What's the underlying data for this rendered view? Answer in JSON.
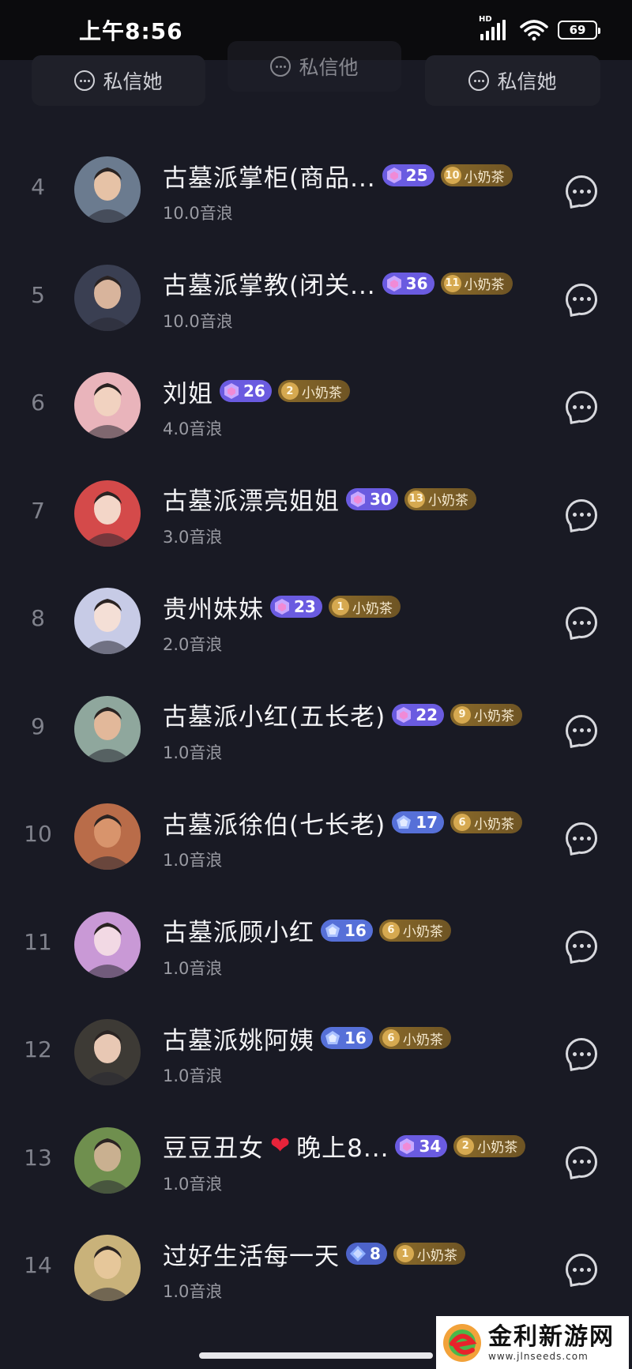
{
  "status_bar": {
    "time": "上午8:56",
    "network_label": "HD",
    "battery": "69"
  },
  "top_buttons": [
    {
      "label": "私信她"
    },
    {
      "label": "私信他"
    },
    {
      "label": "私信她"
    }
  ],
  "list": [
    {
      "rank": "4",
      "name": "古墓派掌柜(商品...",
      "level": "25",
      "level_type": "purple",
      "fan_level": "10",
      "fan_label": "小奶茶",
      "amount": "10.0音浪",
      "avatar_bg": "#6b7b8f",
      "avatar_fg": "#e6c2a6"
    },
    {
      "rank": "5",
      "name": "古墓派掌教(闭关...",
      "level": "36",
      "level_type": "purple",
      "fan_level": "11",
      "fan_label": "小奶茶",
      "amount": "10.0音浪",
      "avatar_bg": "#3a3f52",
      "avatar_fg": "#d8b49c"
    },
    {
      "rank": "6",
      "name": "刘姐",
      "level": "26",
      "level_type": "purple",
      "fan_level": "2",
      "fan_label": "小奶茶",
      "amount": "4.0音浪",
      "avatar_bg": "#e9b4bb",
      "avatar_fg": "#f1d2c0"
    },
    {
      "rank": "7",
      "name": "古墓派漂亮姐姐",
      "level": "30",
      "level_type": "purple",
      "fan_level": "13",
      "fan_label": "小奶茶",
      "amount": "3.0音浪",
      "avatar_bg": "#d44a4a",
      "avatar_fg": "#f3d6c8"
    },
    {
      "rank": "8",
      "name": "贵州妹妹",
      "level": "23",
      "level_type": "purple",
      "fan_level": "1",
      "fan_label": "小奶茶",
      "amount": "2.0音浪",
      "avatar_bg": "#c7cbe6",
      "avatar_fg": "#f4dfd6"
    },
    {
      "rank": "9",
      "name": "古墓派小红(五长老)",
      "level": "22",
      "level_type": "purple",
      "fan_level": "9",
      "fan_label": "小奶茶",
      "amount": "1.0音浪",
      "avatar_bg": "#8fa79d",
      "avatar_fg": "#e2b89a"
    },
    {
      "rank": "10",
      "name": "古墓派徐伯(七长老)",
      "level": "17",
      "level_type": "blue",
      "fan_level": "6",
      "fan_label": "小奶茶",
      "amount": "1.0音浪",
      "avatar_bg": "#b96c49",
      "avatar_fg": "#d8946c"
    },
    {
      "rank": "11",
      "name": "古墓派顾小红",
      "level": "16",
      "level_type": "blue",
      "fan_level": "6",
      "fan_label": "小奶茶",
      "amount": "1.0音浪",
      "avatar_bg": "#c999d6",
      "avatar_fg": "#f2d9e4"
    },
    {
      "rank": "12",
      "name": "古墓派姚阿姨",
      "level": "16",
      "level_type": "blue",
      "fan_level": "6",
      "fan_label": "小奶茶",
      "amount": "1.0音浪",
      "avatar_bg": "#3d3a35",
      "avatar_fg": "#e8c8b4"
    },
    {
      "rank": "13",
      "name": "豆豆丑女",
      "name_suffix": "晚上8...",
      "has_heart": true,
      "level": "34",
      "level_type": "purple",
      "fan_level": "2",
      "fan_label": "小奶茶",
      "amount": "1.0音浪",
      "avatar_bg": "#6f8f4e",
      "avatar_fg": "#c9b090"
    },
    {
      "rank": "14",
      "name": "过好生活每一天",
      "level": "8",
      "level_type": "diamond",
      "fan_level": "1",
      "fan_label": "小奶茶",
      "amount": "1.0音浪",
      "avatar_bg": "#c9b27a",
      "avatar_fg": "#e6c79a"
    }
  ],
  "watermark": {
    "title": "金利新游网",
    "url": "www.jlnseeds.com"
  },
  "colors": {
    "background": "#191a24",
    "level_purple": "#6a5be0",
    "level_blue": "#5670d8",
    "fan_gold": "#8a6a2a"
  }
}
